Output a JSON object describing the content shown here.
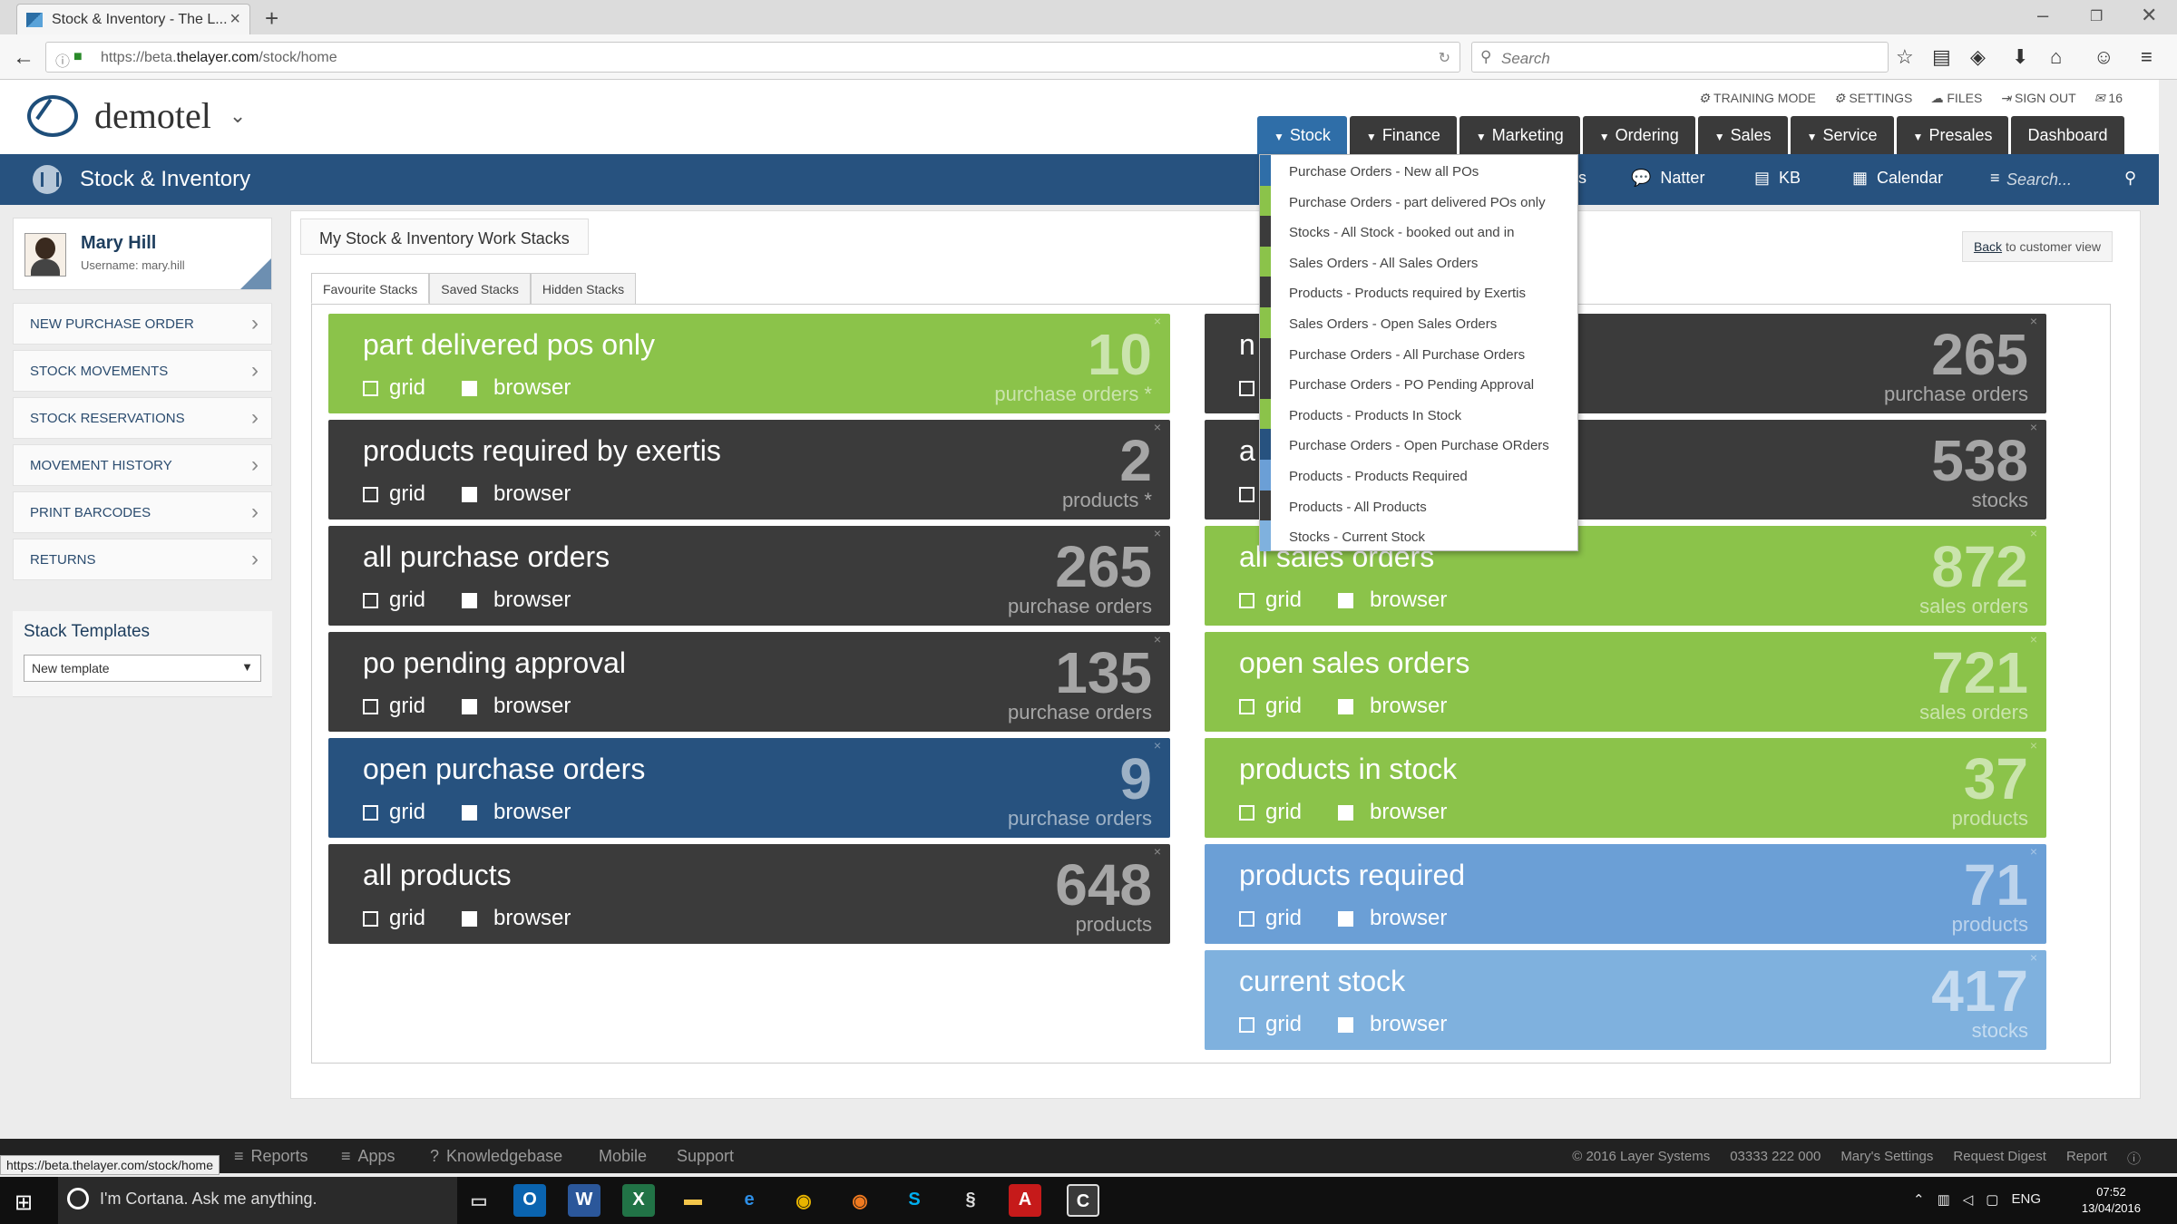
{
  "browser": {
    "tab_title": "Stock & Inventory - The L...",
    "url_prefix": "https://beta.",
    "url_domain": "thelayer.com",
    "url_path": "/stock/home",
    "search_placeholder": "Search"
  },
  "app": {
    "name": "demotel",
    "top_links": [
      {
        "label": "TRAINING MODE",
        "icon": "gear-icon"
      },
      {
        "label": "SETTINGS",
        "icon": "gear-icon"
      },
      {
        "label": "FILES",
        "icon": "cloud-icon"
      },
      {
        "label": "SIGN OUT",
        "icon": "sign-out-icon"
      },
      {
        "label": "16",
        "icon": "chat-icon"
      }
    ],
    "nav": [
      "Stock",
      "Finance",
      "Marketing",
      "Ordering",
      "Sales",
      "Service",
      "Presales",
      "Dashboard"
    ],
    "section_title": "Stock & Inventory",
    "bluebar": {
      "partial": "s",
      "natter": "Natter",
      "kb": "KB",
      "calendar": "Calendar",
      "search": "Search..."
    }
  },
  "user": {
    "name": "Mary Hill",
    "username": "Username: mary.hill"
  },
  "sidebar": [
    "NEW PURCHASE ORDER",
    "STOCK MOVEMENTS",
    "STOCK RESERVATIONS",
    "MOVEMENT HISTORY",
    "PRINT BARCODES",
    "RETURNS"
  ],
  "templates": {
    "title": "Stack Templates",
    "selected": "New template"
  },
  "panel": {
    "title": "My Stock & Inventory Work Stacks",
    "back_link": "Back",
    "back_rest": " to customer view",
    "tabs": [
      "Favourite Stacks",
      "Saved Stacks",
      "Hidden Stacks"
    ],
    "grid_label": "grid",
    "browser_label": "browser"
  },
  "stacks": [
    {
      "title": "part delivered pos only",
      "count": "10",
      "unit": "purchase orders *",
      "color": "green"
    },
    {
      "title": "products required by exertis",
      "count": "2",
      "unit": "products *",
      "color": "dark"
    },
    {
      "title": "all purchase orders",
      "count": "265",
      "unit": "purchase orders",
      "color": "dark"
    },
    {
      "title": "po pending approval",
      "count": "135",
      "unit": "purchase orders",
      "color": "dark"
    },
    {
      "title": "open purchase orders",
      "count": "9",
      "unit": "purchase orders",
      "color": "navy"
    },
    {
      "title": "all products",
      "count": "648",
      "unit": "products",
      "color": "dark"
    },
    {
      "title": "n",
      "count": "265",
      "unit": "purchase orders",
      "color": "dark"
    },
    {
      "title": "a",
      "title_tail": "n",
      "count": "538",
      "unit": "stocks",
      "color": "dark"
    },
    {
      "title": "all sales orders",
      "count": "872",
      "unit": "sales orders",
      "color": "green"
    },
    {
      "title": "open sales orders",
      "count": "721",
      "unit": "sales orders",
      "color": "green"
    },
    {
      "title": "products in stock",
      "count": "37",
      "unit": "products",
      "color": "green"
    },
    {
      "title": "products required",
      "count": "71",
      "unit": "products",
      "color": "blue"
    },
    {
      "title": "current stock",
      "count": "417",
      "unit": "stocks",
      "color": "lblue"
    }
  ],
  "dropdown": [
    {
      "label": "Purchase Orders - New all POs",
      "color": "#2f6ea8"
    },
    {
      "label": "Purchase Orders - part delivered POs only",
      "color": "#8bc34a"
    },
    {
      "label": "Stocks - All Stock - booked out and in",
      "color": "#3b3b3b"
    },
    {
      "label": "Sales Orders - All Sales Orders",
      "color": "#8bc34a"
    },
    {
      "label": "Products - Products required by Exertis",
      "color": "#3b3b3b"
    },
    {
      "label": "Sales Orders - Open Sales Orders",
      "color": "#8bc34a"
    },
    {
      "label": "Purchase Orders - All Purchase Orders",
      "color": "#3b3b3b"
    },
    {
      "label": "Purchase Orders - PO Pending Approval",
      "color": "#3b3b3b"
    },
    {
      "label": "Products - Products In Stock",
      "color": "#8bc34a"
    },
    {
      "label": "Purchase Orders - Open Purchase ORders",
      "color": "#27527f"
    },
    {
      "label": "Products - Products Required",
      "color": "#6b9fd6"
    },
    {
      "label": "Products - All Products",
      "color": "#3b3b3b"
    },
    {
      "label": "Stocks - Current Stock",
      "color": "#7fb1de"
    }
  ],
  "footer": {
    "left": [
      "Reports",
      "Apps",
      "Knowledgebase",
      "Mobile",
      "Support"
    ],
    "right": [
      "© 2016 Layer Systems",
      "03333 222 000",
      "Mary's Settings",
      "Request Digest",
      "Report"
    ],
    "status_url": "https://beta.thelayer.com/stock/home"
  },
  "taskbar": {
    "cortana": "I'm Cortana. Ask me anything.",
    "lang": "ENG",
    "time": "07:52",
    "date": "13/04/2016"
  }
}
